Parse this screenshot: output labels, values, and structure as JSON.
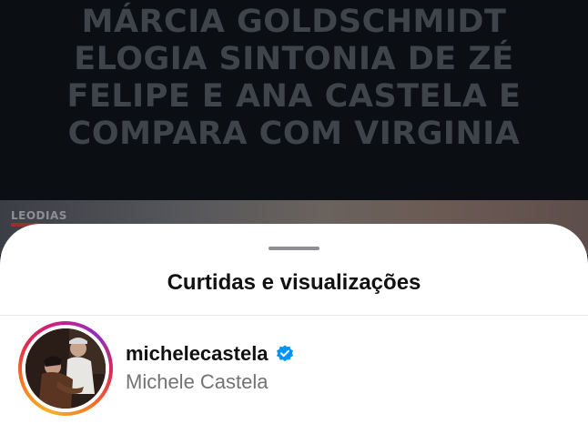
{
  "background_post": {
    "headline_lines": [
      "MÁRCIA GOLDSCHMIDT",
      "ELOGIA SINTONIA DE ZÉ",
      "FELIPE E ANA CASTELA E",
      "COMPARA COM VIRGINIA"
    ],
    "logo_text": "LEODIAS"
  },
  "sheet": {
    "title": "Curtidas e visualizações"
  },
  "user": {
    "username": "michelecastela",
    "full_name": "Michele Castela",
    "verified": true,
    "verified_icon": "verified-badge-icon",
    "story_ring": true
  },
  "colors": {
    "verified_blue": "#0095f6",
    "secondary_text": "#737373",
    "sheet_bg": "#ffffff"
  }
}
